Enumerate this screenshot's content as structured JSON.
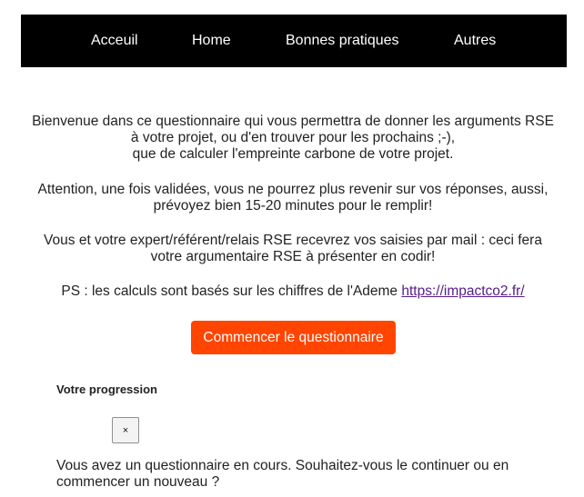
{
  "nav": {
    "items": [
      {
        "label": "Acceuil"
      },
      {
        "label": "Home"
      },
      {
        "label": "Bonnes pratiques"
      },
      {
        "label": "Autres"
      }
    ]
  },
  "intro": {
    "paragraph1": {
      "line1": "Bienvenue dans ce questionnaire qui vous permettra de donner les arguments RSE",
      "line2": "à votre projet, ou d'en trouver pour les prochains ;-),",
      "line3": "que de calculer l'empreinte carbone de votre projet."
    },
    "paragraph2": {
      "line1": "Attention, une fois validées, vous ne pourrez plus revenir sur vos réponses, aussi,",
      "line2": "prévoyez bien 15-20 minutes pour le remplir!"
    },
    "paragraph3": {
      "line1": "Vous et votre expert/référent/relais RSE recevrez vos saisies par mail : ceci fera",
      "line2": "votre argumentaire RSE à présenter en codir!"
    },
    "paragraph4": {
      "text": "PS : les calculs sont basés sur les chiffres de l'Ademe ",
      "link_text": "https://impactco2.fr/"
    }
  },
  "start_button": {
    "label": "Commencer le questionnaire"
  },
  "progress": {
    "title": "Votre progression",
    "close_label": "×"
  },
  "resume": {
    "line1": "Vous avez un questionnaire en cours. Souhaitez-vous le continuer ou en",
    "line2": "commencer un nouveau ?"
  },
  "colors": {
    "navbar_bg": "#000000",
    "accent": "#ff4500",
    "link": "#551a8b"
  }
}
